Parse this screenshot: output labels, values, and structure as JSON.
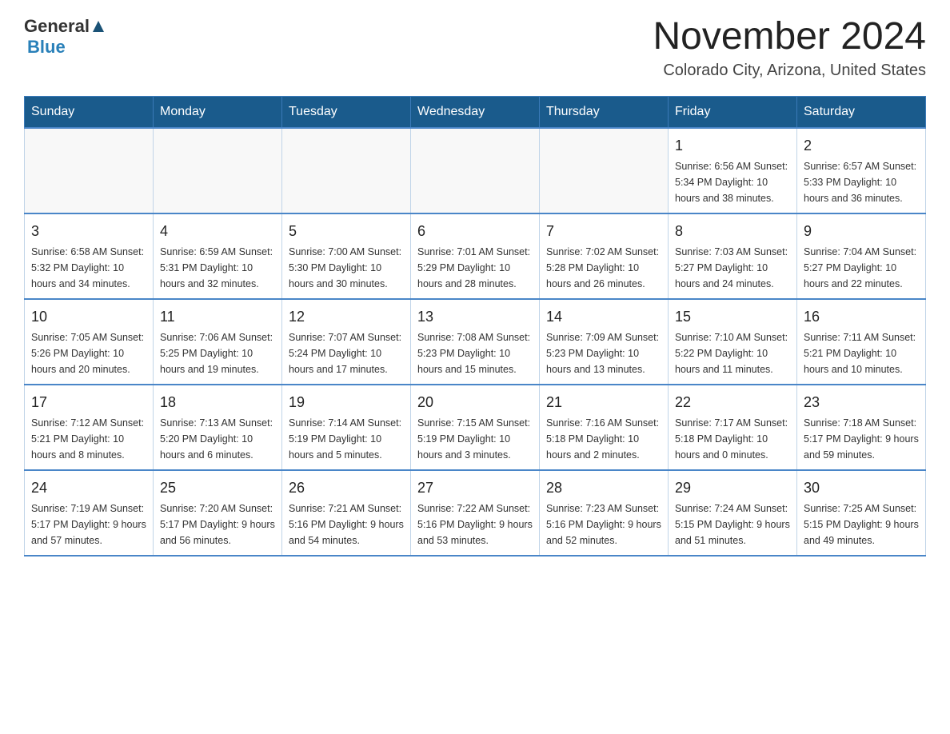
{
  "header": {
    "logo_general": "General",
    "logo_blue": "Blue",
    "month_title": "November 2024",
    "location": "Colorado City, Arizona, United States"
  },
  "days_of_week": [
    "Sunday",
    "Monday",
    "Tuesday",
    "Wednesday",
    "Thursday",
    "Friday",
    "Saturday"
  ],
  "weeks": [
    {
      "days": [
        {
          "num": "",
          "info": ""
        },
        {
          "num": "",
          "info": ""
        },
        {
          "num": "",
          "info": ""
        },
        {
          "num": "",
          "info": ""
        },
        {
          "num": "",
          "info": ""
        },
        {
          "num": "1",
          "info": "Sunrise: 6:56 AM\nSunset: 5:34 PM\nDaylight: 10 hours and 38 minutes."
        },
        {
          "num": "2",
          "info": "Sunrise: 6:57 AM\nSunset: 5:33 PM\nDaylight: 10 hours and 36 minutes."
        }
      ]
    },
    {
      "days": [
        {
          "num": "3",
          "info": "Sunrise: 6:58 AM\nSunset: 5:32 PM\nDaylight: 10 hours and 34 minutes."
        },
        {
          "num": "4",
          "info": "Sunrise: 6:59 AM\nSunset: 5:31 PM\nDaylight: 10 hours and 32 minutes."
        },
        {
          "num": "5",
          "info": "Sunrise: 7:00 AM\nSunset: 5:30 PM\nDaylight: 10 hours and 30 minutes."
        },
        {
          "num": "6",
          "info": "Sunrise: 7:01 AM\nSunset: 5:29 PM\nDaylight: 10 hours and 28 minutes."
        },
        {
          "num": "7",
          "info": "Sunrise: 7:02 AM\nSunset: 5:28 PM\nDaylight: 10 hours and 26 minutes."
        },
        {
          "num": "8",
          "info": "Sunrise: 7:03 AM\nSunset: 5:27 PM\nDaylight: 10 hours and 24 minutes."
        },
        {
          "num": "9",
          "info": "Sunrise: 7:04 AM\nSunset: 5:27 PM\nDaylight: 10 hours and 22 minutes."
        }
      ]
    },
    {
      "days": [
        {
          "num": "10",
          "info": "Sunrise: 7:05 AM\nSunset: 5:26 PM\nDaylight: 10 hours and 20 minutes."
        },
        {
          "num": "11",
          "info": "Sunrise: 7:06 AM\nSunset: 5:25 PM\nDaylight: 10 hours and 19 minutes."
        },
        {
          "num": "12",
          "info": "Sunrise: 7:07 AM\nSunset: 5:24 PM\nDaylight: 10 hours and 17 minutes."
        },
        {
          "num": "13",
          "info": "Sunrise: 7:08 AM\nSunset: 5:23 PM\nDaylight: 10 hours and 15 minutes."
        },
        {
          "num": "14",
          "info": "Sunrise: 7:09 AM\nSunset: 5:23 PM\nDaylight: 10 hours and 13 minutes."
        },
        {
          "num": "15",
          "info": "Sunrise: 7:10 AM\nSunset: 5:22 PM\nDaylight: 10 hours and 11 minutes."
        },
        {
          "num": "16",
          "info": "Sunrise: 7:11 AM\nSunset: 5:21 PM\nDaylight: 10 hours and 10 minutes."
        }
      ]
    },
    {
      "days": [
        {
          "num": "17",
          "info": "Sunrise: 7:12 AM\nSunset: 5:21 PM\nDaylight: 10 hours and 8 minutes."
        },
        {
          "num": "18",
          "info": "Sunrise: 7:13 AM\nSunset: 5:20 PM\nDaylight: 10 hours and 6 minutes."
        },
        {
          "num": "19",
          "info": "Sunrise: 7:14 AM\nSunset: 5:19 PM\nDaylight: 10 hours and 5 minutes."
        },
        {
          "num": "20",
          "info": "Sunrise: 7:15 AM\nSunset: 5:19 PM\nDaylight: 10 hours and 3 minutes."
        },
        {
          "num": "21",
          "info": "Sunrise: 7:16 AM\nSunset: 5:18 PM\nDaylight: 10 hours and 2 minutes."
        },
        {
          "num": "22",
          "info": "Sunrise: 7:17 AM\nSunset: 5:18 PM\nDaylight: 10 hours and 0 minutes."
        },
        {
          "num": "23",
          "info": "Sunrise: 7:18 AM\nSunset: 5:17 PM\nDaylight: 9 hours and 59 minutes."
        }
      ]
    },
    {
      "days": [
        {
          "num": "24",
          "info": "Sunrise: 7:19 AM\nSunset: 5:17 PM\nDaylight: 9 hours and 57 minutes."
        },
        {
          "num": "25",
          "info": "Sunrise: 7:20 AM\nSunset: 5:17 PM\nDaylight: 9 hours and 56 minutes."
        },
        {
          "num": "26",
          "info": "Sunrise: 7:21 AM\nSunset: 5:16 PM\nDaylight: 9 hours and 54 minutes."
        },
        {
          "num": "27",
          "info": "Sunrise: 7:22 AM\nSunset: 5:16 PM\nDaylight: 9 hours and 53 minutes."
        },
        {
          "num": "28",
          "info": "Sunrise: 7:23 AM\nSunset: 5:16 PM\nDaylight: 9 hours and 52 minutes."
        },
        {
          "num": "29",
          "info": "Sunrise: 7:24 AM\nSunset: 5:15 PM\nDaylight: 9 hours and 51 minutes."
        },
        {
          "num": "30",
          "info": "Sunrise: 7:25 AM\nSunset: 5:15 PM\nDaylight: 9 hours and 49 minutes."
        }
      ]
    }
  ]
}
